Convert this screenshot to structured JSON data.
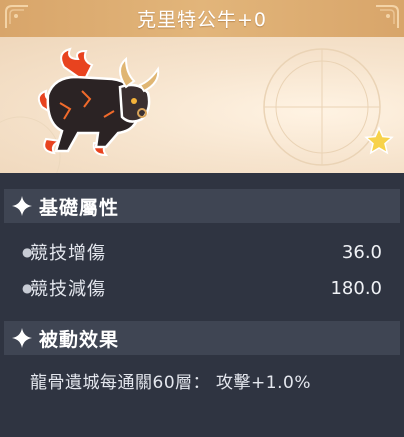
{
  "title": "克里特公牛+0",
  "icons": {
    "decor": "corner-ornament-icon",
    "creature": "flaming-bull-icon",
    "rating": "star-icon",
    "section": "sparkle-icon"
  },
  "colors": {
    "title_bar": "#d8a56a",
    "panel_bg": "#2f3441",
    "section_bg": "#3f4553",
    "star": "#f7d24a"
  },
  "basic_attributes": {
    "label": "基礎屬性",
    "stats": [
      {
        "name": "競技增傷",
        "value": "36.0"
      },
      {
        "name": "競技減傷",
        "value": "180.0"
      }
    ]
  },
  "passive_effect": {
    "label": "被動效果",
    "text": "龍骨遺城每通關60層：  攻擊+1.0%"
  }
}
